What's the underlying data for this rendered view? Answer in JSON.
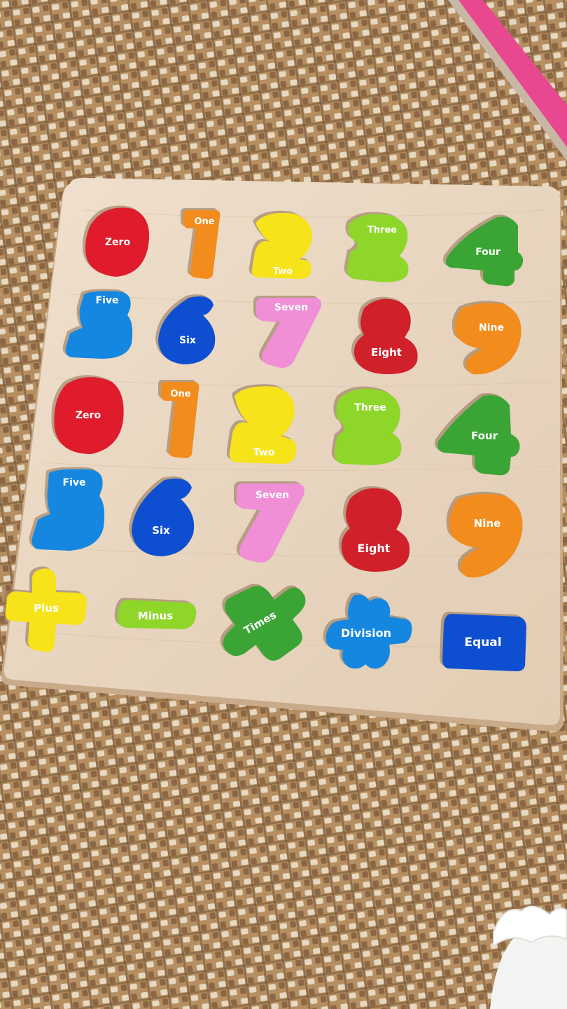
{
  "colors": {
    "mat_base": "#b58f61",
    "mat_light": "#e7d8c2",
    "mat_dark": "#6e4f33",
    "board": "#ead8c3",
    "board_edge": "#c9ab8a",
    "red": "#e01b2b",
    "orange": "#f28c1c",
    "yellow": "#f7e31a",
    "lime": "#8fd62a",
    "green": "#3aa535",
    "blue": "#1687e0",
    "royal": "#0e4fd1",
    "pink": "#f08fd6",
    "crimson": "#d0202a"
  },
  "pieces": [
    {
      "name": "zero",
      "label": "Zero",
      "color": "red"
    },
    {
      "name": "one",
      "label": "One",
      "color": "orange"
    },
    {
      "name": "two",
      "label": "Two",
      "color": "yellow"
    },
    {
      "name": "three",
      "label": "Three",
      "color": "lime"
    },
    {
      "name": "four",
      "label": "Four",
      "color": "green"
    },
    {
      "name": "five",
      "label": "Five",
      "color": "blue"
    },
    {
      "name": "six",
      "label": "Six",
      "color": "royal"
    },
    {
      "name": "seven",
      "label": "Seven",
      "color": "pink"
    },
    {
      "name": "eight",
      "label": "Eight",
      "color": "crimson"
    },
    {
      "name": "nine",
      "label": "Nine",
      "color": "orange"
    },
    {
      "name": "zero-2",
      "label": "Zero",
      "color": "red"
    },
    {
      "name": "one-2",
      "label": "One",
      "color": "orange"
    },
    {
      "name": "two-2",
      "label": "Two",
      "color": "yellow"
    },
    {
      "name": "three-2",
      "label": "Three",
      "color": "lime"
    },
    {
      "name": "four-2",
      "label": "Four",
      "color": "green"
    },
    {
      "name": "five-2",
      "label": "Five",
      "color": "blue"
    },
    {
      "name": "six-2",
      "label": "Six",
      "color": "royal"
    },
    {
      "name": "seven-2",
      "label": "Seven",
      "color": "pink"
    },
    {
      "name": "eight-2",
      "label": "Eight",
      "color": "crimson"
    },
    {
      "name": "nine-2",
      "label": "Nine",
      "color": "orange"
    },
    {
      "name": "plus",
      "label": "Plus",
      "color": "yellow"
    },
    {
      "name": "minus",
      "label": "Minus",
      "color": "lime"
    },
    {
      "name": "times",
      "label": "Times",
      "color": "green"
    },
    {
      "name": "division",
      "label": "Division",
      "color": "blue"
    },
    {
      "name": "equal",
      "label": "Equal",
      "color": "royal"
    }
  ]
}
